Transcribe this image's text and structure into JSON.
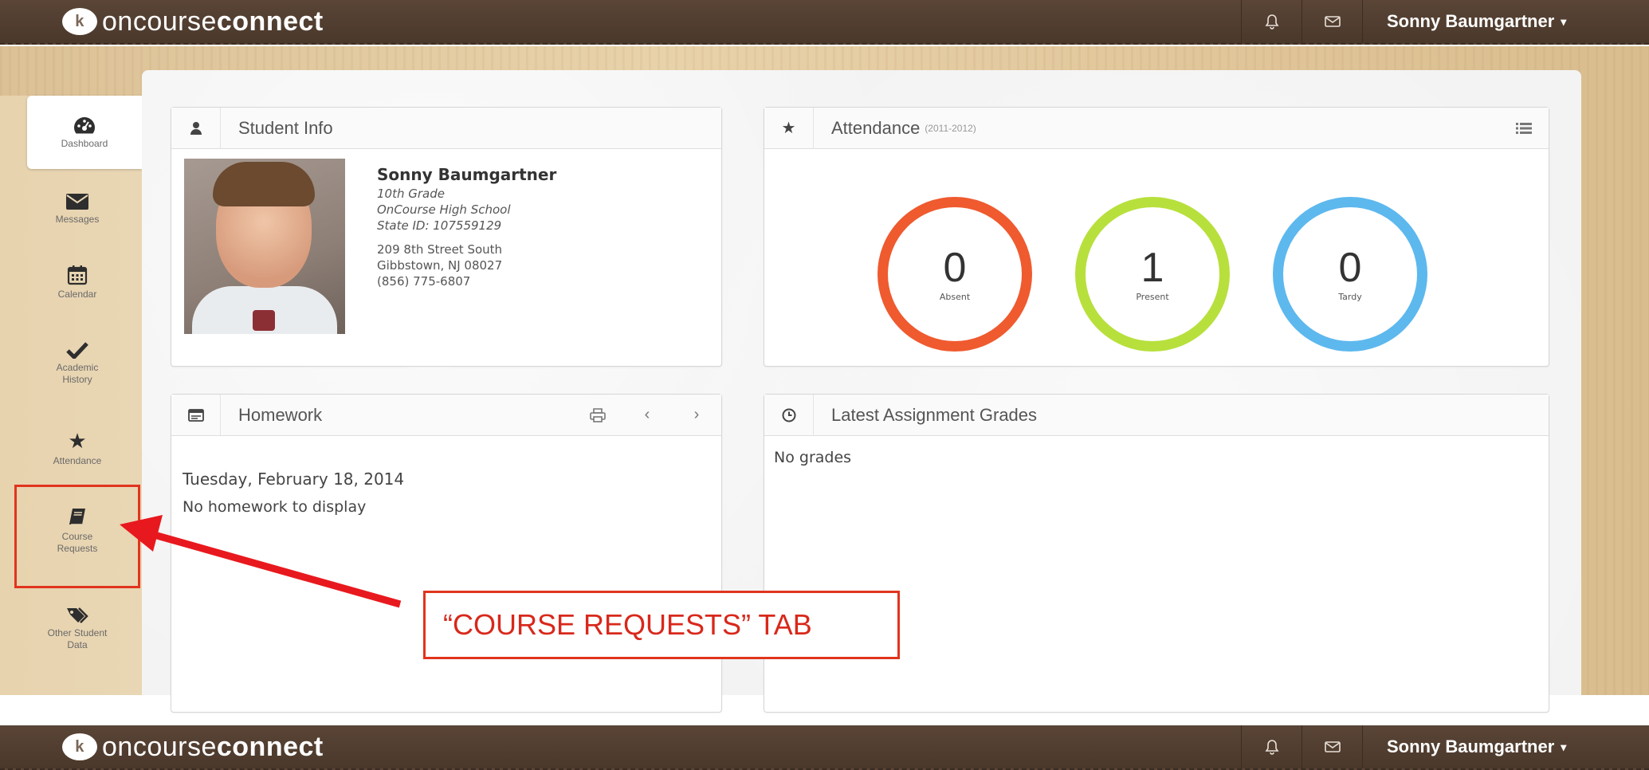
{
  "app": {
    "brand_prefix": "oncourse",
    "brand_suffix": "connect",
    "user_name": "Sonny Baumgartner",
    "icons": {
      "notifications": "bell-icon",
      "mail": "envelope-icon",
      "menu_caret": "caret-down-icon"
    }
  },
  "sidebar": {
    "items": [
      {
        "label": "Dashboard",
        "icon": "dashboard-icon",
        "active": true
      },
      {
        "label": "Messages",
        "icon": "envelope-icon"
      },
      {
        "label": "Calendar",
        "icon": "calendar-icon"
      },
      {
        "label": "Academic History",
        "icon": "checkmark-icon"
      },
      {
        "label": "Attendance",
        "icon": "star-icon"
      },
      {
        "label": "Course Requests",
        "icon": "book-icon",
        "highlighted": true
      },
      {
        "label": "Other Student Data",
        "icon": "tag-icon"
      }
    ]
  },
  "student_info": {
    "title": "Student Info",
    "name": "Sonny Baumgartner",
    "grade": "10th Grade",
    "school": "OnCourse High School",
    "state_id": "State ID: 107559129",
    "address_line1": "209 8th Street South",
    "address_line2": "Gibbstown, NJ 08027",
    "phone": "(856) 775-6807"
  },
  "attendance": {
    "title": "Attendance",
    "year": "(2011-2012)",
    "stats": [
      {
        "value": "0",
        "label": "Absent",
        "color": "#ef5a2f"
      },
      {
        "value": "1",
        "label": "Present",
        "color": "#b7e03c"
      },
      {
        "value": "0",
        "label": "Tardy",
        "color": "#5db8ee"
      }
    ]
  },
  "homework": {
    "title": "Homework",
    "date": "Tuesday, February 18, 2014",
    "empty": "No homework to display"
  },
  "grades": {
    "title": "Latest Assignment Grades",
    "empty": "No grades"
  },
  "annotation": {
    "text": "“COURSE REQUESTS” TAB",
    "color": "#e1341e"
  }
}
